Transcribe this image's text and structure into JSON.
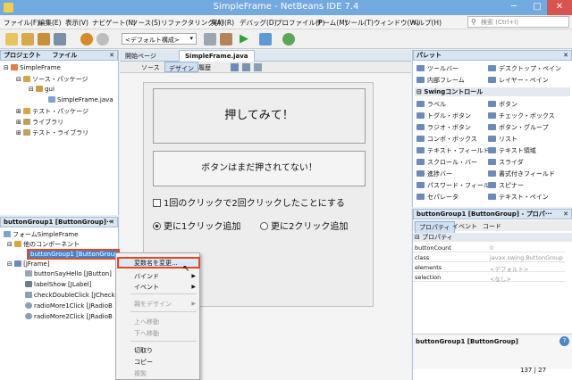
{
  "window": {
    "title": "SimpleFrame - NetBeans IDE 7.4",
    "controls": [
      "─",
      "□",
      "✕"
    ]
  },
  "menu": [
    "ファイル(F)",
    "編集(E)",
    "表示(V)",
    "ナビゲート(N)",
    "ソース(S)",
    "リファクタリング(A)",
    "実行(R)",
    "デバッグ(D)",
    "プロファイル(P)",
    "チーム(M)",
    "ツール(T)",
    "ウィンドウ(W)",
    "ヘルプ(H)"
  ],
  "search": {
    "placeholder": "検索 (Ctrl+I)"
  },
  "toolbar": {
    "config_select": "<デフォルト構成>"
  },
  "projects": {
    "tabs": [
      "プロジェクト",
      "ファイル"
    ],
    "close": "✕",
    "items": [
      "SimpleFrame",
      "ソース・パッケージ",
      "gui",
      "SimpleFrame.java",
      "テスト・パッケージ",
      "ライブラリ",
      "テスト・ライブラリ"
    ]
  },
  "navigator": {
    "title": "buttonGroup1 [ButtonGroup]···",
    "close": "✕",
    "items": [
      "フォームSimpleFrame",
      "他のコンポーネント",
      "buttonGroup1 [ButtonGroup]",
      "[JFrame]",
      "buttonSayHello [JButton]",
      "labelShow [JLabel]",
      "checkDoubleClick [JCheck",
      "radioMore1Click [JRadioB",
      "radioMore2Click [JRadioB"
    ]
  },
  "editor": {
    "tabs": [
      "開始ページ",
      "SimpleFrame.java"
    ],
    "subtabs": [
      "ソース",
      "デザイン",
      "履歴"
    ],
    "form": {
      "button": "押してみて！",
      "label": "ボタンはまだ押されてない！",
      "checkbox": "1回のクリックで2回クリックしたことにする",
      "radio1": "更に1クリック追加",
      "radio2": "更に2クリック追加"
    }
  },
  "palette": {
    "title": "パレット",
    "close": "✕",
    "items": [
      [
        "ツールバー",
        "デスクトップ・ペイン"
      ],
      [
        "内部フレーム",
        "レイヤー・ペイン"
      ]
    ],
    "section": "Swingコントロール",
    "controls": [
      [
        "ラベル",
        "ボタン"
      ],
      [
        "トグル・ボタン",
        "チェック・ボックス"
      ],
      [
        "ラジオ・ボタン",
        "ボタン・グループ"
      ],
      [
        "コンボ・ボックス",
        "リスト"
      ],
      [
        "テキスト・フィールド",
        "テキスト領域"
      ],
      [
        "スクロール・バー",
        "スライダ"
      ],
      [
        "進捗バー",
        "書式付きフィールド"
      ],
      [
        "パスワード・フィールド",
        "スピナー"
      ],
      [
        "セパレータ",
        "テキスト・ペイン"
      ]
    ]
  },
  "properties": {
    "title": "buttonGroup1 [ButtonGroup] - プロパ···",
    "close": "✕",
    "tabs": [
      "プロパティ",
      "イベント",
      "コード"
    ],
    "section": "プロパティ",
    "rows": [
      [
        "buttonCount",
        "0"
      ],
      [
        "class",
        "javax.swing.ButtonGroup"
      ],
      [
        "elements",
        "<デフォルト>"
      ],
      [
        "selection",
        "<なし>"
      ]
    ],
    "footer": "buttonGroup1 [ButtonGroup]",
    "help": "?"
  },
  "context_menu": [
    {
      "label": "変数名を変更...",
      "state": "selected"
    },
    {
      "label": "バインド",
      "submenu": true
    },
    {
      "label": "イベント",
      "submenu": true
    },
    {
      "label": "親をデザイン",
      "submenu": true,
      "state": "disabled"
    },
    {
      "label": "上へ移動",
      "state": "disabled"
    },
    {
      "label": "下へ移動",
      "state": "disabled"
    },
    {
      "label": "切取り"
    },
    {
      "label": "コピー"
    },
    {
      "label": "複製",
      "state": "disabled"
    }
  ],
  "status": {
    "position": "137 | 27"
  },
  "colors": {
    "titlebar": "#72a9de",
    "highlight": "#e8461b",
    "selection": "#3c86d6"
  }
}
